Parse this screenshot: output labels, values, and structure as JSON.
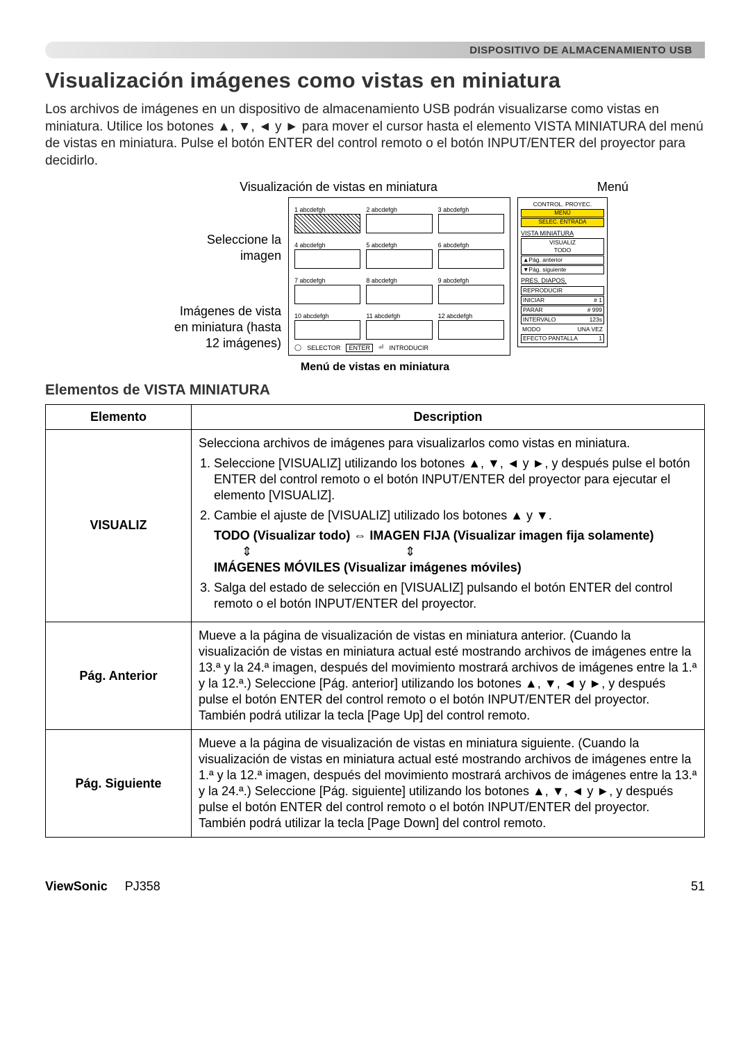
{
  "header": {
    "section": "DISPOSITIVO DE ALMACENAMIENTO USB"
  },
  "title": "Visualización imágenes como vistas en miniatura",
  "intro": "Los archivos de imágenes en un dispositivo de almacenamiento USB podrán visualizarse como vistas en miniatura. Utilice los botones ▲, ▼, ◄ y ► para mover el cursor hasta el elemento VISTA MINIATURA del menú de vistas en miniatura. Pulse el botón ENTER del control remoto o el botón INPUT/ENTER del proyector para decidirlo.",
  "diagram": {
    "top_label_left": "Visualización de vistas en miniatura",
    "top_label_right": "Menú",
    "left_label_1a": "Seleccione la",
    "left_label_1b": "imagen",
    "left_label_2a": "Imágenes de vista",
    "left_label_2b": "en miniatura (hasta",
    "left_label_2c": "12 imágenes)",
    "thumbs": [
      "1 abcdefgh",
      "2 abcdefgh",
      "3 abcdefgh",
      "4 abcdefgh",
      "5 abcdefgh",
      "6 abcdefgh",
      "7 abcdefgh",
      "8 abcdefgh",
      "9 abcdefgh",
      "10 abcdefgh",
      "11 abcdefgh",
      "12 abcdefgh"
    ],
    "footer_selector": "SELECTOR",
    "footer_enter": "ENTER",
    "footer_intro": "INTRODUCIR",
    "menu_h1": "CONTROL. PROYEC.",
    "menu_h2": "MENÚ",
    "menu_h3": "SELEC. ENTRADA",
    "menu_sec1": "VISTA MINIATURA",
    "menu_visualiz": "VISUALIZ",
    "menu_todo": "TODO",
    "menu_pag_ant": "▲Pág. anterior",
    "menu_pag_sig": "▼Pág. siguiente",
    "menu_sec2": "PRES. DIAPOS.",
    "menu_reprod": "REPRODUCIR",
    "menu_iniciar_l": "INICIAR",
    "menu_iniciar_r": "# 1",
    "menu_parar_l": "PARAR",
    "menu_parar_r": "# 999",
    "menu_intervalo_l": "INTERVALO",
    "menu_intervalo_r": "123s",
    "menu_modo_l": "MODO",
    "menu_modo_r": "UNA VEZ",
    "menu_efecto_l": "EFECTO PANTALLA",
    "menu_efecto_r": "1",
    "caption": "Menú de vistas en miniatura"
  },
  "subtitle": "Elementos de VISTA MINIATURA",
  "table": {
    "col1": "Elemento",
    "col2": "Description",
    "row1": {
      "name": "VISUALIZ",
      "intro": "Selecciona archivos de imágenes para visualizarlos como vistas en miniatura.",
      "step1": "Seleccione [VISUALIZ] utilizando los botones ▲, ▼, ◄ y ►, y después pulse el botón ENTER del control remoto o el botón INPUT/ENTER del proyector para ejecutar el elemento [VISUALIZ].",
      "step2": "Cambie el ajuste de [VISUALIZ] utilizado los botones ▲ y ▼.",
      "cycle1": "TODO (Visualizar todo)  ⇔  IMAGEN FIJA (Visualizar imagen fija solamente)",
      "cycle2a": "⇕",
      "cycle2b": "⇕",
      "cycle3": "IMÁGENES MÓVILES (Visualizar imágenes móviles)",
      "step3": "Salga del estado de selección en [VISUALIZ] pulsando el botón ENTER del control remoto o el botón INPUT/ENTER del proyector."
    },
    "row2": {
      "name": "Pág. Anterior",
      "desc": "Mueve a la página de visualización de vistas en miniatura anterior. (Cuando la visualización de vistas en miniatura actual esté mostrando archivos de imágenes entre la 13.ª y la 24.ª imagen, después del movimiento mostrará archivos de imágenes entre la 1.ª y la 12.ª.) Seleccione [Pág. anterior] utilizando los botones ▲, ▼, ◄ y ►, y después pulse el botón ENTER del control remoto o el botón INPUT/ENTER del proyector. También podrá utilizar la tecla [Page Up] del control remoto."
    },
    "row3": {
      "name": "Pág. Siguiente",
      "desc": "Mueve a la página de visualización de vistas en miniatura siguiente. (Cuando la visualización de vistas en miniatura  actual esté mostrando archivos de imágenes entre la 1.ª y la 12.ª imagen, después del movimiento mostrará archivos de imágenes entre la 13.ª y la 24.ª.) Seleccione [Pág. siguiente] utilizando los botones ▲, ▼, ◄ y ►, y después pulse el botón ENTER del control remoto o el botón INPUT/ENTER del proyector. También podrá utilizar la tecla [Page Down] del control remoto."
    }
  },
  "footer": {
    "brand": "ViewSonic",
    "model": "PJ358",
    "page": "51"
  }
}
